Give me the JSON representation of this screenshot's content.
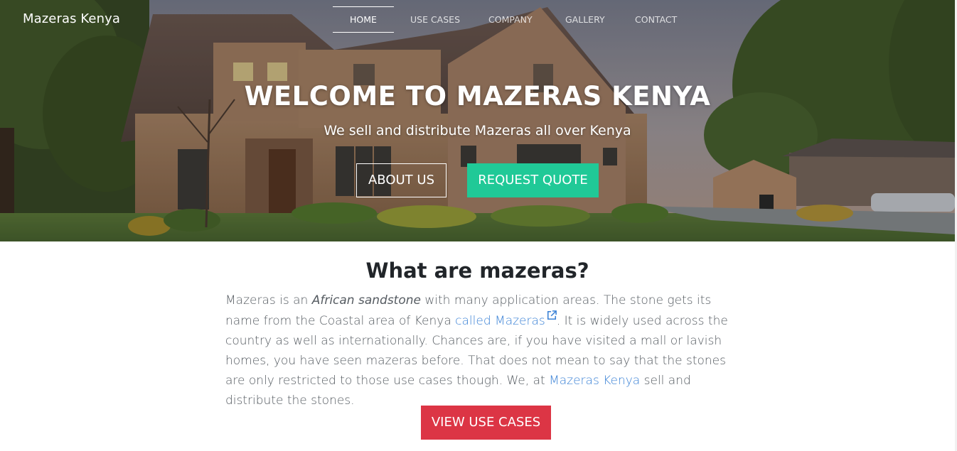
{
  "header": {
    "brand": "Mazeras Kenya",
    "nav": [
      {
        "label": "HOME",
        "active": true
      },
      {
        "label": "USE CASES",
        "active": false
      },
      {
        "label": "COMPANY",
        "active": false
      },
      {
        "label": "GALLERY",
        "active": false
      },
      {
        "label": "CONTACT",
        "active": false
      }
    ]
  },
  "hero": {
    "title": "WELCOME TO MAZERAS KENYA",
    "subtitle": "We sell and distribute Mazeras all over Kenya",
    "about_label": "ABOUT US",
    "quote_label": "REQUEST QUOTE"
  },
  "intro": {
    "heading": "What are mazeras?",
    "text_1": "Mazeras is an ",
    "text_italic": "African sandstone",
    "text_2": " with many application areas. The stone gets its name from the Coastal area of Kenya ",
    "link_1": "called Mazeras",
    "text_3": ". It is widely used across the country as well as internationally. Chances are, if you have visited a mall or lavish homes, you have seen mazeras before. That does not mean to say that the stones are only restricted to those use cases though. We, at ",
    "link_2": "Mazeras Kenya",
    "text_4": " sell and distribute the stones.",
    "button_label": "VIEW USE CASES"
  },
  "colors": {
    "quote_button": "#20c997",
    "use_cases_button": "#dc3545",
    "link": "#3b82d6"
  }
}
